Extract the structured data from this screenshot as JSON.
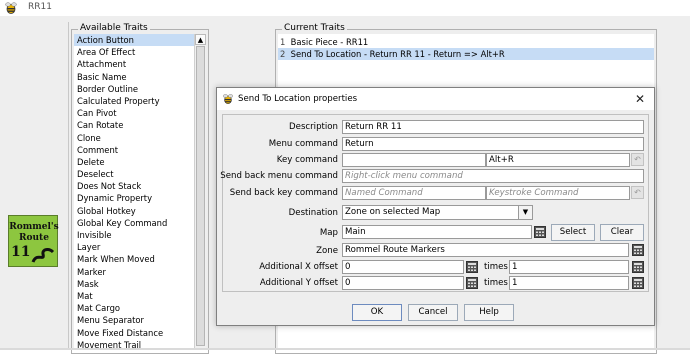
{
  "window": {
    "title": "RR11",
    "icon": "bee-icon"
  },
  "piece": {
    "line1": "Rommel's",
    "line2": "Route",
    "line3": "11",
    "color": "#8dc63f"
  },
  "available_traits": {
    "title": "Available Traits",
    "items": [
      "Action Button",
      "Area Of Effect",
      "Attachment",
      "Basic Name",
      "Border Outline",
      "Calculated Property",
      "Can Pivot",
      "Can Rotate",
      "Clone",
      "Comment",
      "Delete",
      "Deselect",
      "Does Not Stack",
      "Dynamic Property",
      "Global Hotkey",
      "Global Key Command",
      "Invisible",
      "Layer",
      "Mark When Moved",
      "Marker",
      "Mask",
      "Mat",
      "Mat Cargo",
      "Menu Separator",
      "Move Fixed Distance",
      "Movement Trail"
    ],
    "selected_index": 0
  },
  "current_traits": {
    "title": "Current Traits",
    "items": [
      {
        "num": "1",
        "label": "Basic Piece - RR11"
      },
      {
        "num": "2",
        "label": "Send To Location - Return RR 11 - Return => Alt+R"
      }
    ],
    "selected_index": 1
  },
  "dialog": {
    "title": "Send To Location properties",
    "close": "✕",
    "description_label": "Description",
    "description_value": "Return RR 11",
    "menu_command_label": "Menu command",
    "menu_command_value": "Return",
    "key_command_label": "Key command",
    "key_command_value": "",
    "key_command_stroke": "Alt+R",
    "send_back_menu_label": "Send back menu command",
    "send_back_menu_placeholder": "Right-click menu command",
    "send_back_key_label": "Send back key command",
    "send_back_key_placeholder": "Named Command",
    "send_back_keystroke_placeholder": "Keystroke Command",
    "destination_label": "Destination",
    "destination_value": "Zone on selected Map",
    "map_label": "Map",
    "map_value": "Main",
    "select_button": "Select",
    "clear_button": "Clear",
    "zone_label": "Zone",
    "zone_value": "Rommel Route Markers",
    "x_offset_label": "Additional X offset",
    "x_offset_value": "0",
    "x_times_label": "times",
    "x_times_value": "1",
    "y_offset_label": "Additional Y offset",
    "y_offset_value": "0",
    "y_times_label": "times",
    "y_times_value": "1",
    "ok_button": "OK",
    "cancel_button": "Cancel",
    "help_button": "Help"
  }
}
